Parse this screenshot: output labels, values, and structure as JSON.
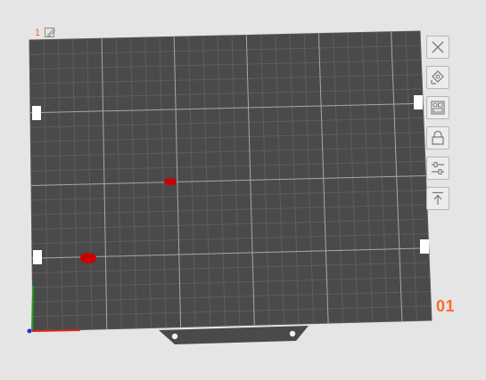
{
  "plate": {
    "index_label": "1",
    "name_label": "01"
  },
  "toolbar": {
    "buttons": [
      {
        "icon": "close-icon"
      },
      {
        "icon": "auto-orient-icon"
      },
      {
        "icon": "arrange-icon"
      },
      {
        "icon": "lock-icon"
      },
      {
        "icon": "plate-settings-icon"
      },
      {
        "icon": "move-to-top-icon"
      }
    ]
  },
  "colors": {
    "bed": "#4a4a4a",
    "grid": "#5a5a5a",
    "grid_major": "#aaaaaa",
    "object": "#cc0000",
    "accent": "#ff6a2a",
    "x_axis": "#e02020",
    "y_axis": "#1fa01f"
  },
  "objects": [
    {
      "name": "small-red-object"
    },
    {
      "name": "red-object"
    }
  ]
}
